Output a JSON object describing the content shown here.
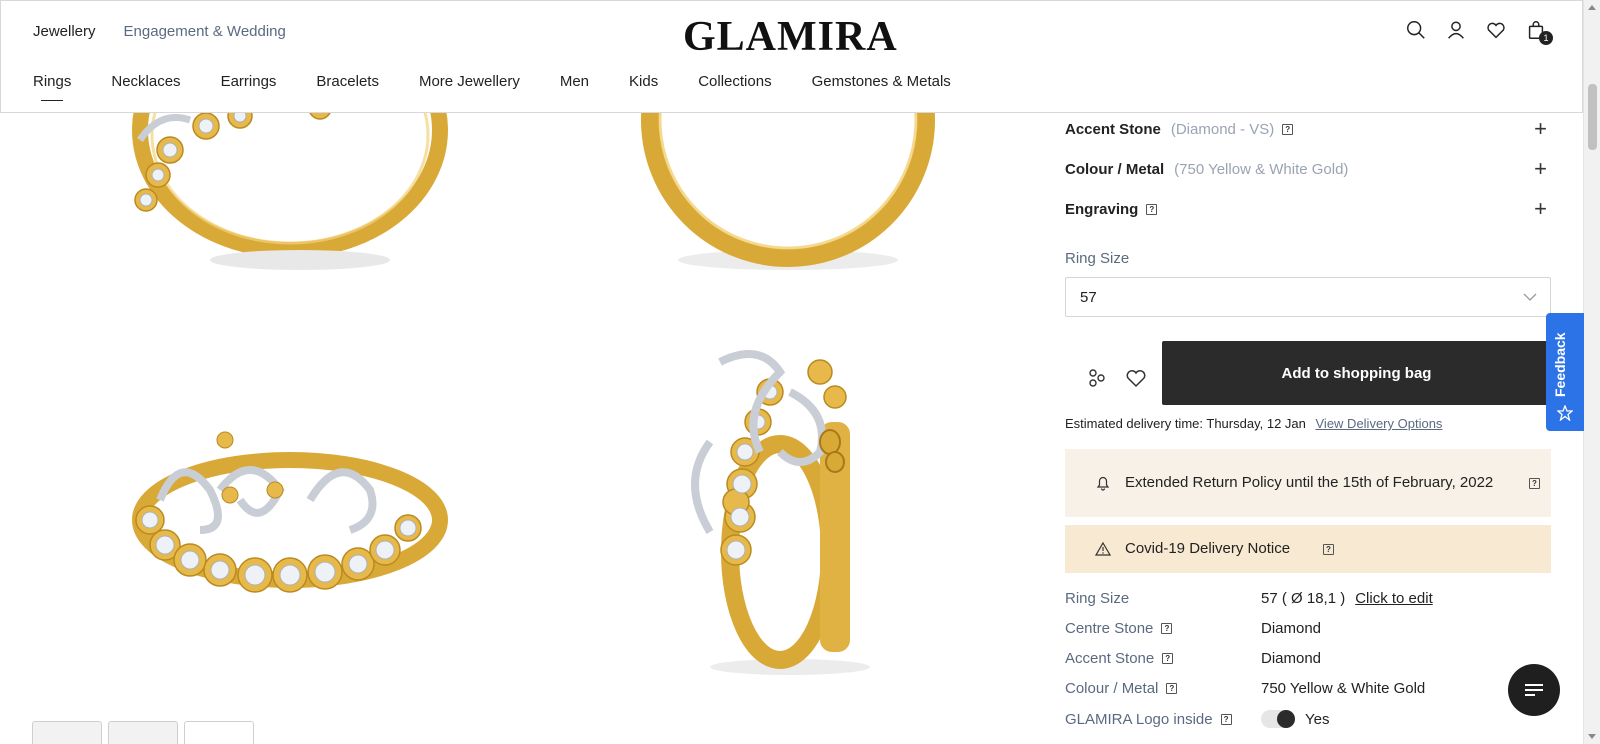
{
  "header": {
    "top_nav": [
      "Jewellery",
      "Engagement & Wedding"
    ],
    "logo": "GLAMIRA",
    "cart_count": "1",
    "categories": [
      "Rings",
      "Necklaces",
      "Earrings",
      "Bracelets",
      "More Jewellery",
      "Men",
      "Kids",
      "Collections",
      "Gemstones & Metals"
    ],
    "icons": [
      "search-icon",
      "user-icon",
      "heart-icon",
      "bag-icon"
    ]
  },
  "options": {
    "accent_stone": {
      "label": "Accent Stone",
      "value": "(Diamond - VS)"
    },
    "colour_metal": {
      "label": "Colour / Metal",
      "value": "(750 Yellow & White Gold)"
    },
    "engraving": {
      "label": "Engraving"
    }
  },
  "ring_size": {
    "label": "Ring Size",
    "selected": "57"
  },
  "add_to_bag": "Add to shopping bag",
  "delivery": {
    "prefix": "Estimated delivery time:",
    "date": "Thursday, 12 Jan",
    "link": "View Delivery Options"
  },
  "notices": {
    "return_policy": "Extended Return Policy until the 15th of February, 2022",
    "covid": "Covid-19 Delivery Notice"
  },
  "specs": {
    "ring_size": {
      "label": "Ring Size",
      "value": "57 ( Ø 18,1 )",
      "edit": "Click to edit"
    },
    "centre_stone": {
      "label": "Centre Stone",
      "value": "Diamond"
    },
    "accent_stone": {
      "label": "Accent Stone",
      "value": "Diamond"
    },
    "colour_metal": {
      "label": "Colour / Metal",
      "value": "750 Yellow & White Gold"
    },
    "logo_inside": {
      "label": "GLAMIRA Logo inside",
      "value": "Yes"
    }
  },
  "feedback": "Feedback",
  "colors": {
    "gold": "#d9a937",
    "dark": "#2b2b2b",
    "accent_blue": "#2c73e8",
    "notice_bg": "#f7f1e8",
    "covid_bg": "#f8ead2"
  }
}
